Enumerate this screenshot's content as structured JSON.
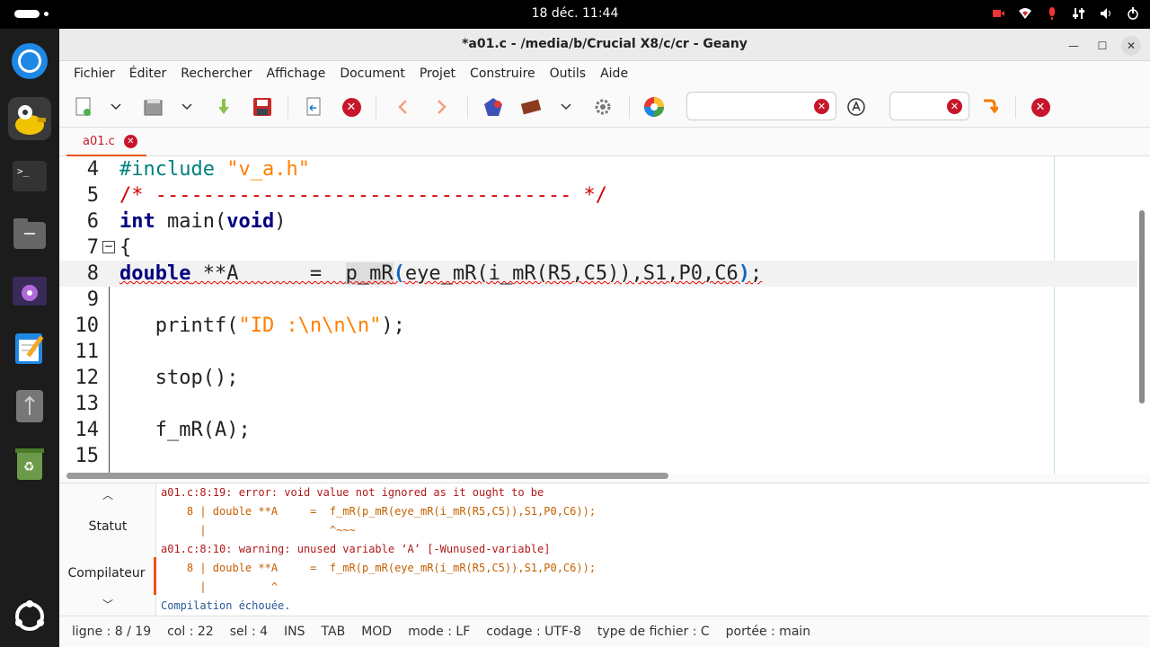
{
  "system": {
    "clock": "18 déc.  11:44"
  },
  "window": {
    "title": "*a01.c - /media/b/Crucial X8/c/cr - Geany"
  },
  "menu": [
    "Fichier",
    "Éditer",
    "Rechercher",
    "Affichage",
    "Document",
    "Projet",
    "Construire",
    "Outils",
    "Aide"
  ],
  "tabs": [
    {
      "label": "a01.c"
    }
  ],
  "editor": {
    "lines": [
      {
        "num": "4",
        "code": "#include \"v_a.h\""
      },
      {
        "num": "5",
        "code": "/* ----------------------------------- */"
      },
      {
        "num": "6",
        "code": "int main(void)"
      },
      {
        "num": "7",
        "code": "{"
      },
      {
        "num": "8",
        "code": "double **A      =  p_mR(eye_mR(i_mR(R5,C5)),S1,P0,C6);"
      },
      {
        "num": "9",
        "code": ""
      },
      {
        "num": "10",
        "code": "   printf(\"ID :\\n\\n\\n\");"
      },
      {
        "num": "11",
        "code": ""
      },
      {
        "num": "12",
        "code": "   stop();"
      },
      {
        "num": "13",
        "code": ""
      },
      {
        "num": "14",
        "code": "   f_mR(A);"
      },
      {
        "num": "15",
        "code": ""
      }
    ]
  },
  "messages": {
    "side": {
      "status": "Statut",
      "compiler": "Compilateur"
    },
    "lines": [
      "a01.c:8:19: error: void value not ignored as it ought to be",
      "    8 | double **A     =  f_mR(p_mR(eye_mR(i_mR(R5,C5)),S1,P0,C6));",
      "      |                   ^~~~",
      "a01.c:8:10: warning: unused variable ‘A’ [-Wunused-variable]",
      "    8 | double **A     =  f_mR(p_mR(eye_mR(i_mR(R5,C5)),S1,P0,C6));",
      "      |          ^",
      "Compilation échouée."
    ]
  },
  "status": {
    "line": "ligne : 8 / 19",
    "col": "col : 22",
    "sel": "sel : 4",
    "ins": "INS",
    "tab": "TAB",
    "mod": "MOD",
    "mode": "mode : LF",
    "encoding": "codage : UTF-8",
    "filetype": "type de fichier : C",
    "scope": "portée : main"
  },
  "colors": {
    "accent": "#e95420",
    "error": "#c7162b"
  }
}
